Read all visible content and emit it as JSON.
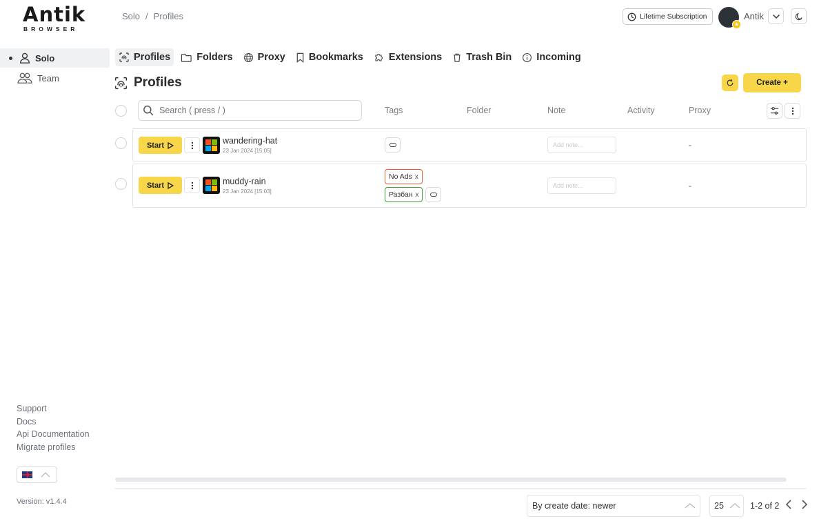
{
  "logo": {
    "main": "Antik",
    "sub": "BROWSER"
  },
  "breadcrumb": {
    "root": "Solo",
    "sep": "/",
    "current": "Profiles"
  },
  "header": {
    "subscription_label": "Lifetime Subscription",
    "username": "Antik"
  },
  "sidebar": {
    "items": [
      {
        "label": "Solo",
        "icon": "user-icon",
        "active": true
      },
      {
        "label": "Team",
        "icon": "users-icon",
        "active": false
      }
    ],
    "links": [
      "Support",
      "Docs",
      "Api Documentation",
      "Migrate profiles"
    ],
    "language": "en-GB",
    "version": "Version: v1.4.4"
  },
  "tabs": [
    {
      "label": "Profiles",
      "icon": "fingerprint-icon",
      "active": true
    },
    {
      "label": "Folders",
      "icon": "folder-icon",
      "active": false
    },
    {
      "label": "Proxy",
      "icon": "globe-icon",
      "active": false
    },
    {
      "label": "Bookmarks",
      "icon": "bookmark-icon",
      "active": false
    },
    {
      "label": "Extensions",
      "icon": "puzzle-icon",
      "active": false
    },
    {
      "label": "Trash Bin",
      "icon": "trash-icon",
      "active": false
    },
    {
      "label": "Incoming",
      "icon": "info-icon",
      "active": false
    }
  ],
  "page": {
    "title": "Profiles",
    "create_label": "Create +"
  },
  "search": {
    "placeholder": "Search ( press / )",
    "value": ""
  },
  "columns": {
    "tags": "Tags",
    "folder": "Folder",
    "note": "Note",
    "activity": "Activity",
    "proxy": "Proxy"
  },
  "profiles": [
    {
      "start_label": "Start",
      "name": "wandering-hat",
      "date": "23 Jan 2024 [15:05]",
      "tags": [],
      "note_placeholder": "Add note...",
      "proxy": "-"
    },
    {
      "start_label": "Start",
      "name": "muddy-rain",
      "date": "23 Jan 2024 [15:03]",
      "tags": [
        {
          "label": "No Ads",
          "color": "#e05a2b"
        },
        {
          "label": "Разбан",
          "color": "#3a9d3a"
        }
      ],
      "note_placeholder": "Add note...",
      "proxy": "-"
    }
  ],
  "tag_remove": "x",
  "footer": {
    "sort_value": "By create date: newer",
    "per_page": "25",
    "pagination": "1-2 of 2"
  },
  "colors": {
    "accent": "#f7d64a",
    "os_red": "#f25022",
    "os_green": "#7fba00",
    "os_blue": "#00a4ef",
    "os_yellow": "#ffb900"
  }
}
